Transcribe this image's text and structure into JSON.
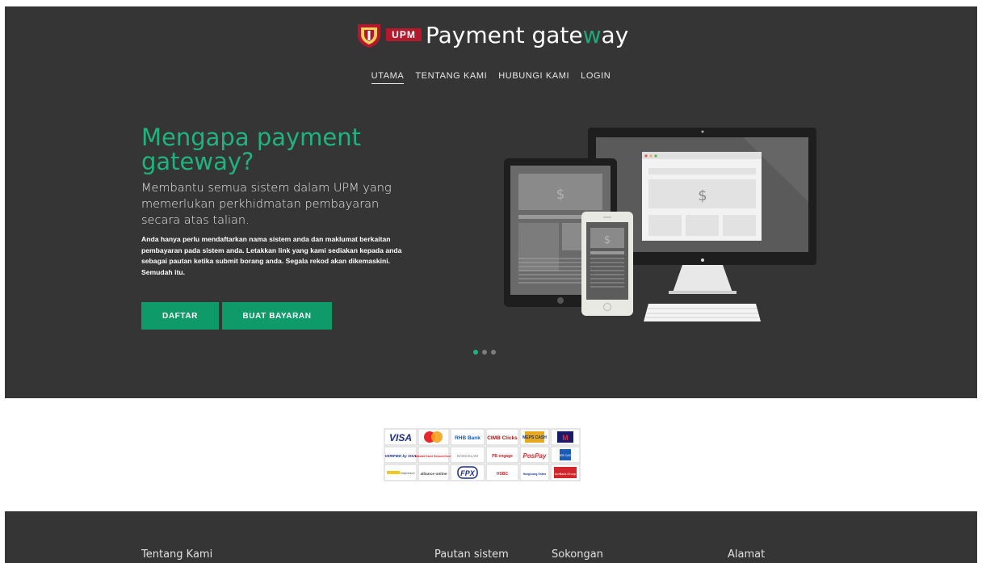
{
  "brand": {
    "logo_text": "UPM",
    "title_pre": "Payment gate",
    "title_w": "w",
    "title_post": "ay"
  },
  "nav": [
    {
      "label": "UTAMA",
      "active": true
    },
    {
      "label": "TENTANG KAMI"
    },
    {
      "label": "HUBUNGI KAMI"
    },
    {
      "label": "LOGIN"
    }
  ],
  "hero": {
    "headline": "Mengapa payment gateway?",
    "lead": "Membantu semua sistem dalam UPM yang memerlukan perkhidmatan pembayaran secara atas talian.",
    "body": "Anda hanya perlu mendaftarkan nama sistem anda dan maklumat berkaitan pembayaran pada sistem anda. Letakkan link yang kami sediakan kepada anda sebagai pautan ketika submit borang anda. Segala rekod akan dikemaskini. Semudah itu.",
    "btn_daftar": "DAFTAR",
    "btn_bayar": "BUAT BAYARAN",
    "slider": {
      "count": 3,
      "active": 1
    }
  },
  "device_mock": {
    "currency_symbol": "$"
  },
  "payments": [
    "VISA",
    "MasterCard",
    "RHB Bank",
    "CIMB Clicks",
    "MEPS CASH",
    "M",
    "VERIFIED by VISA",
    "MasterCard SecureCode",
    "BANKISLAM",
    "PB engage",
    "PosPay",
    "WEB CASH",
    "Maybank2u",
    "alliance online",
    "FPX",
    "HSBC",
    "HongLeong Online",
    "AmBank Group"
  ],
  "footer": {
    "tentang": "Tentang Kami",
    "pautan": "Pautan sistem",
    "sokongan": "Sokongan",
    "alamat": "Alamat"
  },
  "colors": {
    "accent": "#1fb47f",
    "button": "#0f9a6a",
    "dark": "#353535",
    "upm_red": "#b4182d"
  }
}
